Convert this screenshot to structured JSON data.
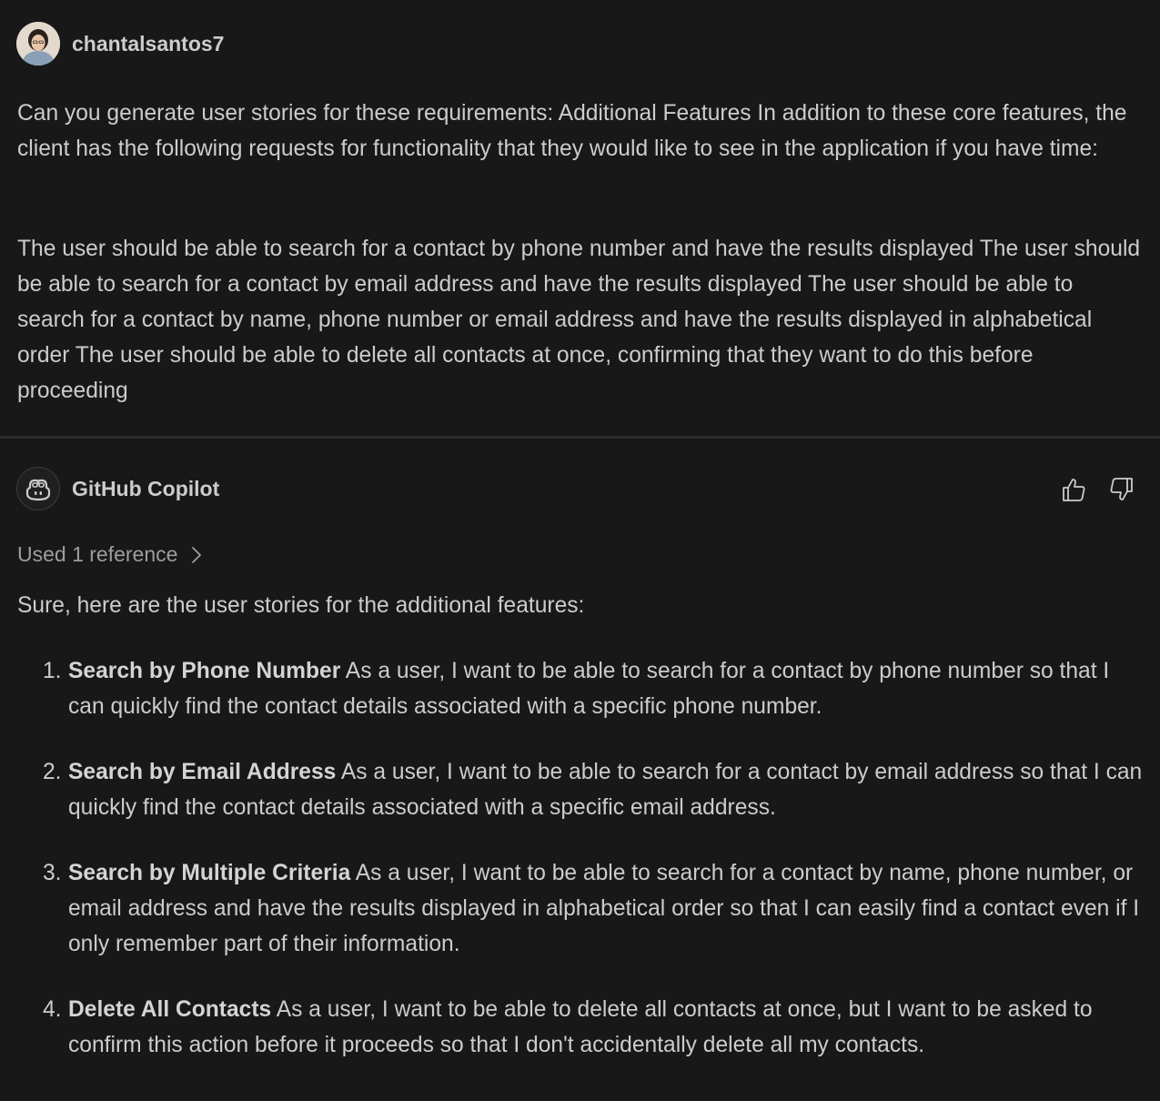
{
  "user_message": {
    "author": "chantalsantos7",
    "paragraphs": [
      "Can you generate user stories for these requirements: Additional Features In addition to these core features, the client has the following requests for functionality that they would like to see in the application if you have time:",
      "The user should be able to search for a contact by phone number and have the results displayed The user should be able to search for a contact by email address and have the results displayed The user should be able to search for a contact by name, phone number or email address and have the results displayed in alphabetical order The user should be able to delete all contacts at once, confirming that they want to do this before proceeding"
    ]
  },
  "assistant_message": {
    "author": "GitHub Copilot",
    "reference_label": "Used 1 reference",
    "intro": "Sure, here are the user stories for the additional features:",
    "stories": [
      {
        "number": "1.",
        "title": "Search by Phone Number",
        "text": "As a user, I want to be able to search for a contact by phone number so that I can quickly find the contact details associated with a specific phone number."
      },
      {
        "number": "2.",
        "title": "Search by Email Address",
        "text": "As a user, I want to be able to search for a contact by email address so that I can quickly find the contact details associated with a specific email address."
      },
      {
        "number": "3.",
        "title": "Search by Multiple Criteria",
        "text": "As a user, I want to be able to search for a contact by name, phone number, or email address and have the results displayed in alphabetical order so that I can easily find a contact even if I only remember part of their information."
      },
      {
        "number": "4.",
        "title": "Delete All Contacts",
        "text": "As a user, I want to be able to delete all contacts at once, but I want to be asked to confirm this action before it proceeds so that I don't accidentally delete all my contacts."
      }
    ],
    "feedback": {
      "helpful_icon": "thumbs-up-icon",
      "unhelpful_icon": "thumbs-down-icon"
    }
  },
  "colors": {
    "background": "#181818",
    "text": "#cccccc",
    "muted_text": "#9d9d9d",
    "divider": "#2b2b2b"
  }
}
